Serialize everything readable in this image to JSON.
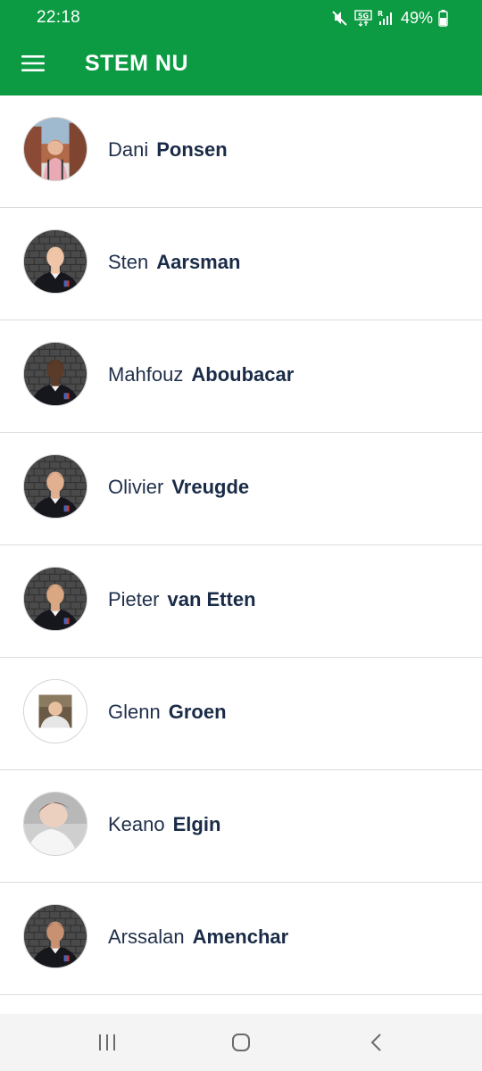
{
  "status_bar": {
    "time": "22:18",
    "battery": "49%",
    "icons": [
      "mute-icon",
      "5g-icon",
      "signal-icon",
      "battery-icon"
    ]
  },
  "app_bar": {
    "title": "STEM NU",
    "menu_icon": "hamburger-menu-icon"
  },
  "players": [
    {
      "first": "Dani",
      "last": "Ponsen",
      "avatar": "photo-outdoor"
    },
    {
      "first": "Sten",
      "last": "Aarsman",
      "avatar": "photo-brick"
    },
    {
      "first": "Mahfouz",
      "last": "Aboubacar",
      "avatar": "photo-brick"
    },
    {
      "first": "Olivier",
      "last": "Vreugde",
      "avatar": "photo-brick"
    },
    {
      "first": "Pieter",
      "last": "van Etten",
      "avatar": "photo-brick"
    },
    {
      "first": "Glenn",
      "last": "Groen",
      "avatar": "photo-small"
    },
    {
      "first": "Keano",
      "last": "Elgin",
      "avatar": "photo-selfie"
    },
    {
      "first": "Arssalan",
      "last": "Amenchar",
      "avatar": "photo-brick"
    }
  ],
  "nav_bar": {
    "icons": [
      "recent-apps-icon",
      "home-icon",
      "back-icon"
    ]
  },
  "colors": {
    "primary": "#0c9a43",
    "name_text": "#1a2b47",
    "divider": "#dcdcdc"
  }
}
